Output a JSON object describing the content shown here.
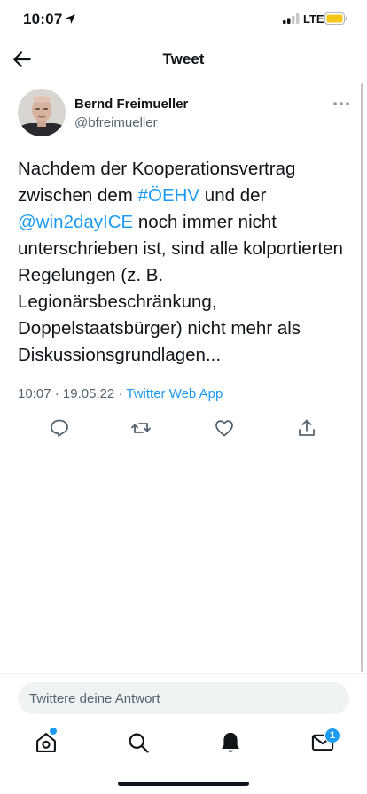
{
  "status_bar": {
    "time": "10:07",
    "network": "LTE"
  },
  "nav": {
    "title": "Tweet"
  },
  "author": {
    "name": "Bernd Freimueller",
    "handle": "@bfreimueller"
  },
  "tweet": {
    "segments": [
      {
        "text": "Nachdem der Kooperationsvertrag zwischen dem ",
        "link": false
      },
      {
        "text": "#ÖEHV",
        "link": true
      },
      {
        "text": " und der ",
        "link": false
      },
      {
        "text": "@win2dayICE",
        "link": true
      },
      {
        "text": " noch immer nicht unterschrieben ist, sind alle kolportierten Regelungen (z. B. Legionärsbeschränkung, Doppelstaatsbürger) nicht mehr als Diskussionsgrundlagen...",
        "link": false
      }
    ],
    "time": "10:07",
    "date": "19.05.22",
    "separator": "·",
    "source": "Twitter Web App"
  },
  "actions": [
    "reply-icon",
    "retweet-icon",
    "like-icon",
    "share-icon"
  ],
  "reply": {
    "placeholder": "Twittere deine Antwort"
  },
  "tabbar": {
    "items": [
      "home-icon",
      "search-icon",
      "notifications-icon",
      "messages-icon"
    ],
    "messages_badge": "1"
  },
  "colors": {
    "accent": "#1d9bf0",
    "text": "#0f1419",
    "secondary": "#536471",
    "battery": "#f5c518"
  }
}
